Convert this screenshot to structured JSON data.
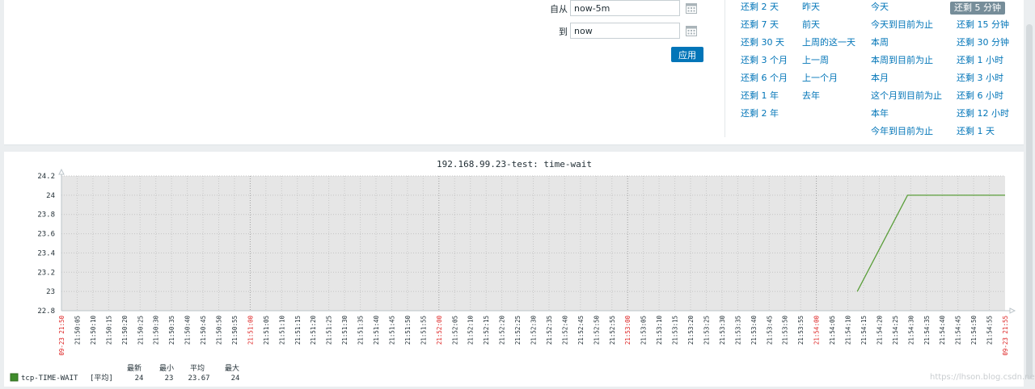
{
  "filter": {
    "from_label": "自从",
    "from_value": "now-5m",
    "to_label": "到",
    "to_value": "now",
    "apply_label": "应用",
    "calendar_icon": "calendar-icon"
  },
  "quick_ranges": {
    "col1": [
      "还剩 2 天",
      "还剩 7 天",
      "还剩 30 天",
      "还剩 3 个月",
      "还剩 6 个月",
      "还剩 1 年",
      "还剩 2 年"
    ],
    "col2": [
      "昨天",
      "前天",
      "上周的这一天",
      "上一周",
      "上一个月",
      "去年"
    ],
    "col3": [
      "今天",
      "今天到目前为止",
      "本周",
      "本周到目前为止",
      "本月",
      "这个月到目前为止",
      "本年",
      "今年到目前为止"
    ],
    "col4": [
      "还剩 5 分钟",
      "还剩 15 分钟",
      "还剩 30 分钟",
      "还剩 1 小时",
      "还剩 3 小时",
      "还剩 6 小时",
      "还剩 12 小时",
      "还剩 1 天"
    ],
    "selected": "还剩 5 分钟"
  },
  "chart_data": {
    "type": "line",
    "title": "192.168.99.23-test: time-wait",
    "xlabel": "",
    "ylabel": "",
    "ylim": [
      22.8,
      24.2
    ],
    "yticks": [
      "24.2",
      "24",
      "23.8",
      "23.6",
      "23.4",
      "23.2",
      "23",
      "22.8"
    ],
    "x_start": "09-23 21:50",
    "x_end": "09-23 21:55",
    "x_start_seconds": 0,
    "x_end_seconds": 300,
    "xticks": [
      "21:50:05",
      "21:50:10",
      "21:50:15",
      "21:50:20",
      "21:50:25",
      "21:50:30",
      "21:50:35",
      "21:50:40",
      "21:50:45",
      "21:50:50",
      "21:50:55",
      "21:51:00",
      "21:51:05",
      "21:51:10",
      "21:51:15",
      "21:51:20",
      "21:51:25",
      "21:51:30",
      "21:51:35",
      "21:51:40",
      "21:51:45",
      "21:51:50",
      "21:51:55",
      "21:52:00",
      "21:52:05",
      "21:52:10",
      "21:52:15",
      "21:52:20",
      "21:52:25",
      "21:52:30",
      "21:52:35",
      "21:52:40",
      "21:52:45",
      "21:52:50",
      "21:52:55",
      "21:53:00",
      "21:53:05",
      "21:53:10",
      "21:53:15",
      "21:53:20",
      "21:53:25",
      "21:53:30",
      "21:53:35",
      "21:53:40",
      "21:53:45",
      "21:53:50",
      "21:53:55",
      "21:54:00",
      "21:54:05",
      "21:54:10",
      "21:54:15",
      "21:54:20",
      "21:54:25",
      "21:54:30",
      "21:54:35",
      "21:54:40",
      "21:54:45",
      "21:54:50",
      "21:54:55"
    ],
    "major_ticks": [
      "21:51:00",
      "21:52:00",
      "21:53:00",
      "21:54:00"
    ],
    "series": [
      {
        "name": "tcp-TIME-WAIT",
        "color": "#5a9e3a",
        "x_seconds": [
          253,
          269,
          300
        ],
        "values": [
          23,
          24,
          24
        ]
      }
    ],
    "grid": true,
    "legend": {
      "headers": [
        "最新",
        "最小",
        "平均",
        "最大"
      ],
      "rows": [
        {
          "name": "tcp-TIME-WAIT",
          "func": "[平均]",
          "last": "24",
          "min": "23",
          "avg": "23.67",
          "max": "24",
          "color": "#3f8c2c"
        }
      ]
    }
  },
  "colors": {
    "link": "#0275b8",
    "button": "#0275b8",
    "selected_range": "#768d99",
    "tick_red": "#dd2222",
    "plot_bg": "#e6e6e6",
    "line": "#5a9e3a"
  },
  "watermark": "https://lhson.blog.csdn.net"
}
